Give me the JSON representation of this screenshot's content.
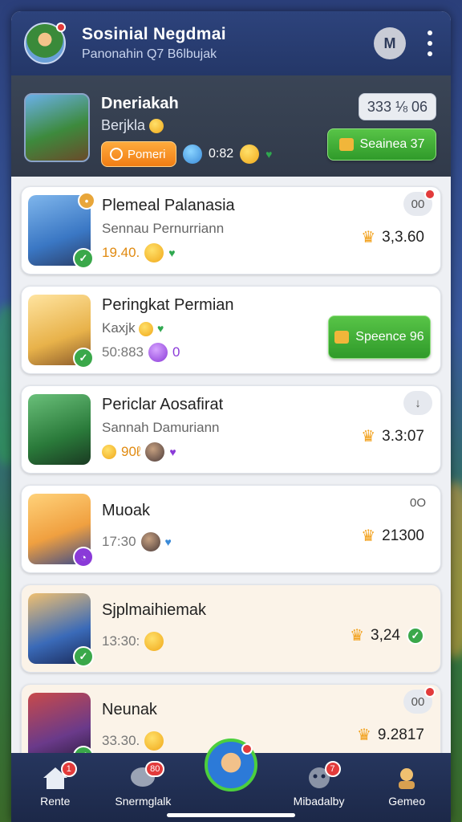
{
  "header": {
    "title": "Sosinial Negdmai",
    "subtitle": "Panonahin Q7 B6lbujak",
    "action_label": "M"
  },
  "featured": {
    "title": "Dneriakah",
    "subtitle": "Berjkla",
    "pill_label": "Pomeri",
    "meta_value": "0:82",
    "score": "333 ⅛ 06",
    "button_label": "Seainea 37"
  },
  "cards": [
    {
      "title": "Plemeal Palanasia",
      "subtitle": "Sennau Pernurriann",
      "meta": "19.40.",
      "score": "3,3.60",
      "corner": "00",
      "thumb_color": "#3a77c4"
    },
    {
      "title": "Peringkat Permian",
      "subtitle": "Kaxjk",
      "meta": "50:883",
      "meta2": "0",
      "button_label": "Speence 96",
      "thumb_color": "#e8b24a"
    },
    {
      "title": "Periclar Aosafirat",
      "subtitle": "Sannah Damuriann",
      "meta": "90ℓ",
      "score": "3.3:07",
      "corner": "↓",
      "thumb_color": "#2a7a3a"
    },
    {
      "title": "Muoak",
      "meta": "17:30",
      "score": "21300",
      "corner": "0O",
      "thumb_color": "#f0a040"
    },
    {
      "title": "Sjplmaihiemak",
      "meta": "13:30:",
      "score": "3,24",
      "thumb_color": "#3a6ab8"
    },
    {
      "title": "Neunak",
      "meta": "33.30.",
      "score": "9.2817",
      "corner": "00",
      "thumb_color": "#6a3a8a"
    }
  ],
  "nav": [
    {
      "label": "Rente",
      "badge": "1"
    },
    {
      "label": "Snermglalk",
      "badge": "80"
    },
    {
      "label": "",
      "badge": ""
    },
    {
      "label": "Mibadalby",
      "badge": "7"
    },
    {
      "label": "Gemeo",
      "badge": ""
    }
  ]
}
